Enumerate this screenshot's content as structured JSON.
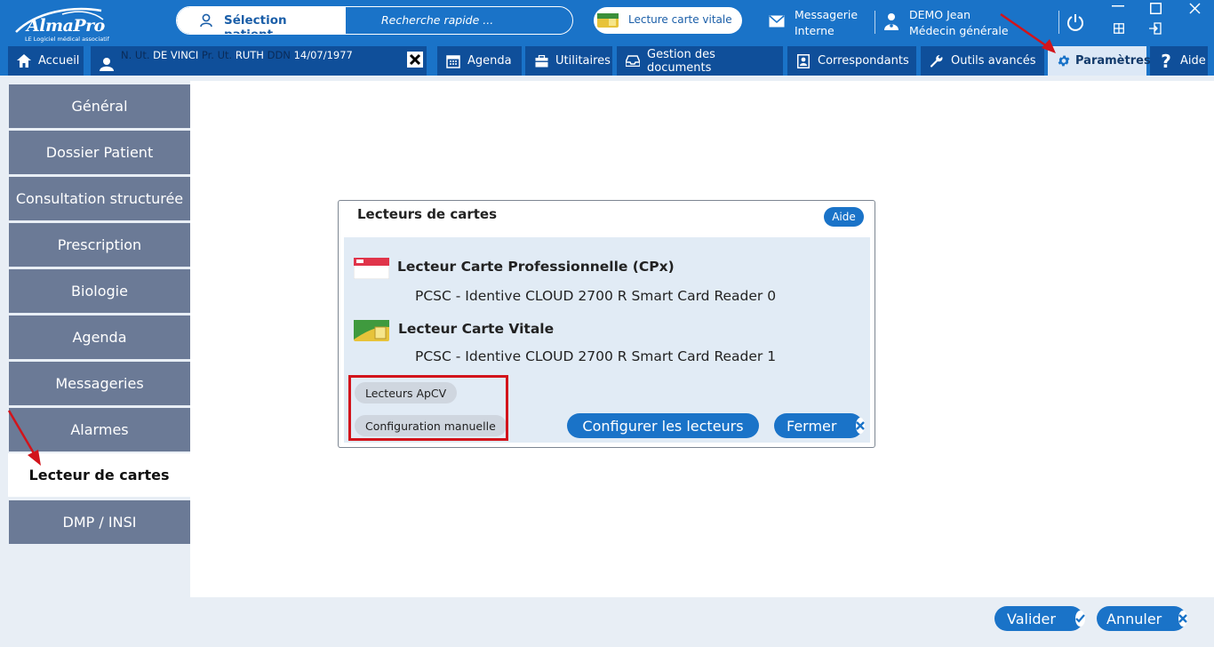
{
  "header": {
    "logo": {
      "brand": "AlmaPro",
      "tagline": "LE Logiciel médical associatif"
    },
    "patient_select_label": "Sélection patient...",
    "quick_search_placeholder": "Recherche rapide ...",
    "vitale_button": "Lecture carte vitale",
    "messaging": {
      "line1": "Messagerie",
      "line2": "Interne"
    },
    "user": {
      "name": "DEMO Jean",
      "role": "Médecin générale"
    }
  },
  "tabs": {
    "home": "Accueil",
    "patient": {
      "nom_label": "N. Ut.",
      "nom": "DE VINCI",
      "prenom_label": "Pr. Ut.",
      "prenom": "RUTH",
      "ddn_label": "DDN",
      "ddn": "14/07/1977"
    },
    "agenda": "Agenda",
    "utilitaires": "Utilitaires",
    "documents": "Gestion des documents",
    "correspondants": "Correspondants",
    "outils": "Outils avancés",
    "parametres": "Paramètres",
    "aide": "Aide"
  },
  "sidebar": {
    "items": [
      {
        "label": "Général"
      },
      {
        "label": "Dossier Patient"
      },
      {
        "label": "Consultation structurée"
      },
      {
        "label": "Prescription"
      },
      {
        "label": "Biologie"
      },
      {
        "label": "Agenda"
      },
      {
        "label": "Messageries"
      },
      {
        "label": "Alarmes"
      },
      {
        "label": "Lecteur de cartes"
      },
      {
        "label": "DMP / INSI"
      }
    ],
    "active_index": 8
  },
  "dialog": {
    "title": "Lecteurs de cartes",
    "help_button": "Aide",
    "cpx": {
      "title": "Lecteur Carte Professionnelle (CPx)",
      "value": "PCSC - Identive CLOUD 2700 R Smart Card Reader 0"
    },
    "vitale": {
      "title": "Lecteur Carte Vitale",
      "value": "PCSC - Identive CLOUD 2700 R Smart Card Reader 1"
    },
    "chip_apcv": "Lecteurs ApCV",
    "chip_manual": "Configuration manuelle",
    "configure_button": "Configurer les lecteurs",
    "close_button": "Fermer"
  },
  "footer": {
    "validate_button": "Valider",
    "cancel_button": "Annuler"
  },
  "colors": {
    "brand_blue": "#1a73c8",
    "dark_tab": "#0f4f9a",
    "sidebar_item": "#6b7a96",
    "highlight_red": "#d2141b"
  }
}
